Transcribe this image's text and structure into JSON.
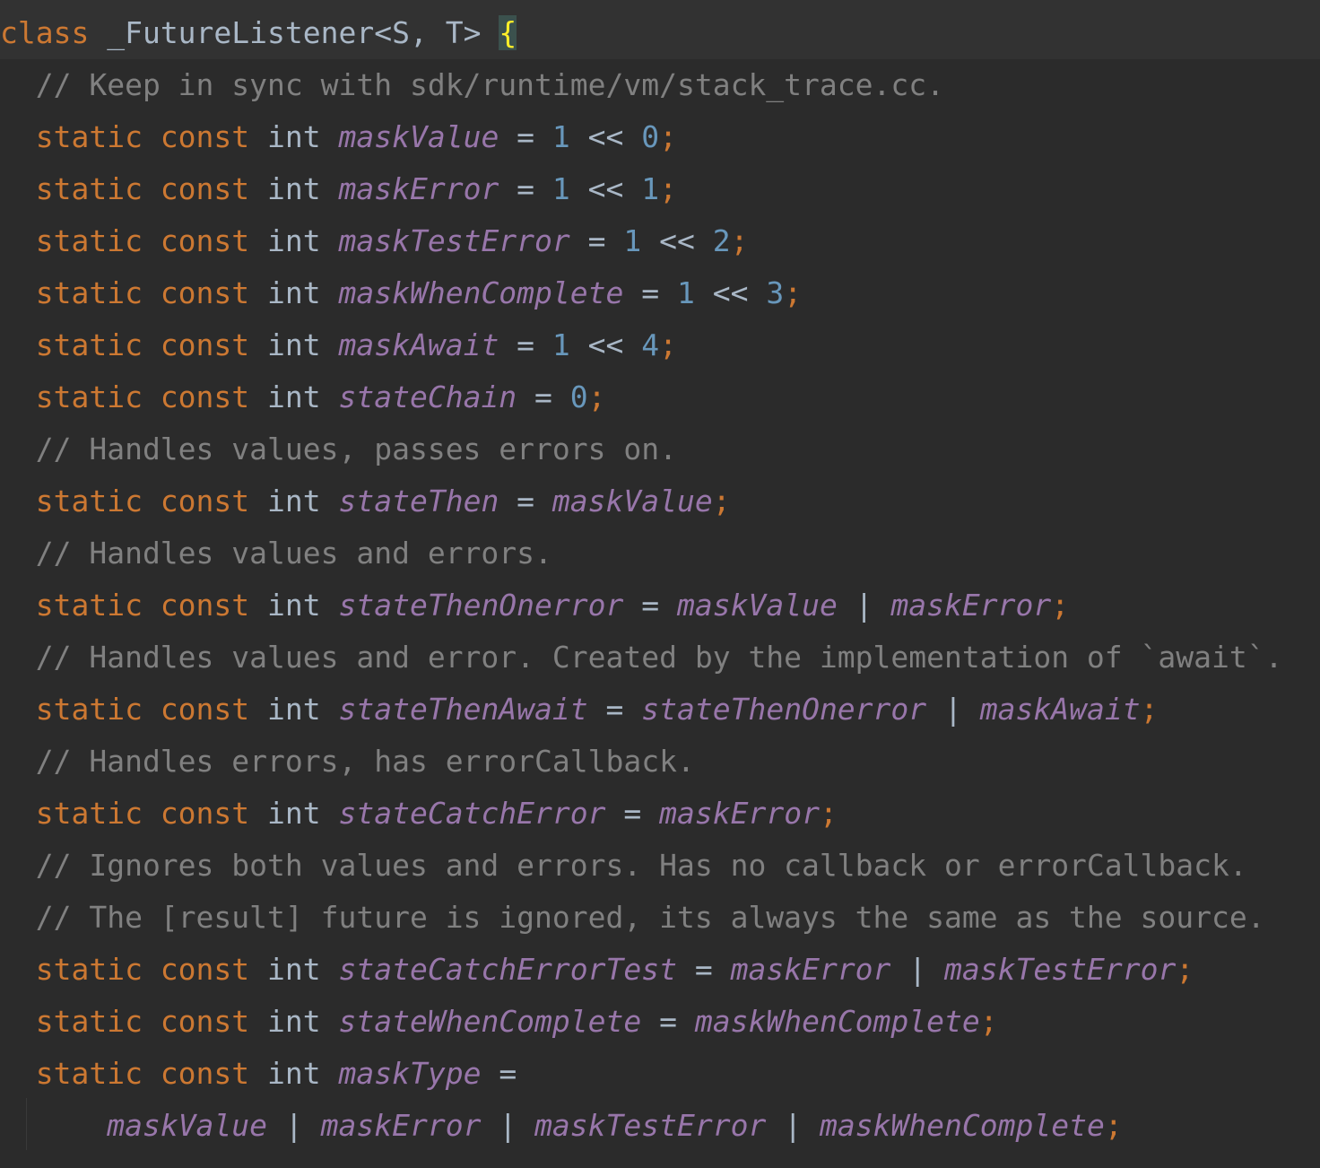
{
  "editor": {
    "colors": {
      "background": "#2b2b2b",
      "keyword": "#cc7832",
      "field": "#9876aa",
      "number": "#6897bb",
      "comment": "#808080",
      "text": "#a9b7c6",
      "brace_highlight": "#ffef28"
    },
    "lines": [
      {
        "tokens": [
          {
            "t": "kw",
            "v": "class"
          },
          {
            "t": "op",
            "v": " _FutureListener<S, T> "
          },
          {
            "t": "brace",
            "v": "{"
          }
        ]
      },
      {
        "tokens": [
          {
            "t": "cmt",
            "v": "  // Keep in sync with sdk/runtime/vm/stack_trace.cc."
          }
        ]
      },
      {
        "tokens": [
          {
            "t": "kw",
            "v": "  static const "
          },
          {
            "t": "op",
            "v": "int "
          },
          {
            "t": "fld",
            "v": "maskValue"
          },
          {
            "t": "op",
            "v": " = "
          },
          {
            "t": "num",
            "v": "1"
          },
          {
            "t": "op",
            "v": " << "
          },
          {
            "t": "num",
            "v": "0"
          },
          {
            "t": "semi",
            "v": ";"
          }
        ]
      },
      {
        "tokens": [
          {
            "t": "kw",
            "v": "  static const "
          },
          {
            "t": "op",
            "v": "int "
          },
          {
            "t": "fld",
            "v": "maskError"
          },
          {
            "t": "op",
            "v": " = "
          },
          {
            "t": "num",
            "v": "1"
          },
          {
            "t": "op",
            "v": " << "
          },
          {
            "t": "num",
            "v": "1"
          },
          {
            "t": "semi",
            "v": ";"
          }
        ]
      },
      {
        "tokens": [
          {
            "t": "kw",
            "v": "  static const "
          },
          {
            "t": "op",
            "v": "int "
          },
          {
            "t": "fld",
            "v": "maskTestError"
          },
          {
            "t": "op",
            "v": " = "
          },
          {
            "t": "num",
            "v": "1"
          },
          {
            "t": "op",
            "v": " << "
          },
          {
            "t": "num",
            "v": "2"
          },
          {
            "t": "semi",
            "v": ";"
          }
        ]
      },
      {
        "tokens": [
          {
            "t": "kw",
            "v": "  static const "
          },
          {
            "t": "op",
            "v": "int "
          },
          {
            "t": "fld",
            "v": "maskWhenComplete"
          },
          {
            "t": "op",
            "v": " = "
          },
          {
            "t": "num",
            "v": "1"
          },
          {
            "t": "op",
            "v": " << "
          },
          {
            "t": "num",
            "v": "3"
          },
          {
            "t": "semi",
            "v": ";"
          }
        ]
      },
      {
        "tokens": [
          {
            "t": "kw",
            "v": "  static const "
          },
          {
            "t": "op",
            "v": "int "
          },
          {
            "t": "fld",
            "v": "maskAwait"
          },
          {
            "t": "op",
            "v": " = "
          },
          {
            "t": "num",
            "v": "1"
          },
          {
            "t": "op",
            "v": " << "
          },
          {
            "t": "num",
            "v": "4"
          },
          {
            "t": "semi",
            "v": ";"
          }
        ]
      },
      {
        "tokens": [
          {
            "t": "kw",
            "v": "  static const "
          },
          {
            "t": "op",
            "v": "int "
          },
          {
            "t": "fld",
            "v": "stateChain"
          },
          {
            "t": "op",
            "v": " = "
          },
          {
            "t": "num",
            "v": "0"
          },
          {
            "t": "semi",
            "v": ";"
          }
        ]
      },
      {
        "tokens": [
          {
            "t": "cmt",
            "v": "  // Handles values, passes errors on."
          }
        ]
      },
      {
        "tokens": [
          {
            "t": "kw",
            "v": "  static const "
          },
          {
            "t": "op",
            "v": "int "
          },
          {
            "t": "fld",
            "v": "stateThen"
          },
          {
            "t": "op",
            "v": " = "
          },
          {
            "t": "fld",
            "v": "maskValue"
          },
          {
            "t": "semi",
            "v": ";"
          }
        ]
      },
      {
        "tokens": [
          {
            "t": "cmt",
            "v": "  // Handles values and errors."
          }
        ]
      },
      {
        "tokens": [
          {
            "t": "kw",
            "v": "  static const "
          },
          {
            "t": "op",
            "v": "int "
          },
          {
            "t": "fld",
            "v": "stateThenOnerror"
          },
          {
            "t": "op",
            "v": " = "
          },
          {
            "t": "fld",
            "v": "maskValue"
          },
          {
            "t": "op",
            "v": " | "
          },
          {
            "t": "fld",
            "v": "maskError"
          },
          {
            "t": "semi",
            "v": ";"
          }
        ]
      },
      {
        "tokens": [
          {
            "t": "cmt",
            "v": "  // Handles values and error. Created by the implementation of `await`."
          }
        ]
      },
      {
        "tokens": [
          {
            "t": "kw",
            "v": "  static const "
          },
          {
            "t": "op",
            "v": "int "
          },
          {
            "t": "fld",
            "v": "stateThenAwait"
          },
          {
            "t": "op",
            "v": " = "
          },
          {
            "t": "fld",
            "v": "stateThenOnerror"
          },
          {
            "t": "op",
            "v": " | "
          },
          {
            "t": "fld",
            "v": "maskAwait"
          },
          {
            "t": "semi",
            "v": ";"
          }
        ]
      },
      {
        "tokens": [
          {
            "t": "cmt",
            "v": "  // Handles errors, has errorCallback."
          }
        ]
      },
      {
        "tokens": [
          {
            "t": "kw",
            "v": "  static const "
          },
          {
            "t": "op",
            "v": "int "
          },
          {
            "t": "fld",
            "v": "stateCatchError"
          },
          {
            "t": "op",
            "v": " = "
          },
          {
            "t": "fld",
            "v": "maskError"
          },
          {
            "t": "semi",
            "v": ";"
          }
        ]
      },
      {
        "tokens": [
          {
            "t": "cmt",
            "v": "  // Ignores both values and errors. Has no callback or errorCallback."
          }
        ]
      },
      {
        "tokens": [
          {
            "t": "cmt",
            "v": "  // The [result] future is ignored, its always the same as the source."
          }
        ]
      },
      {
        "tokens": [
          {
            "t": "kw",
            "v": "  static const "
          },
          {
            "t": "op",
            "v": "int "
          },
          {
            "t": "fld",
            "v": "stateCatchErrorTest"
          },
          {
            "t": "op",
            "v": " = "
          },
          {
            "t": "fld",
            "v": "maskError"
          },
          {
            "t": "op",
            "v": " | "
          },
          {
            "t": "fld",
            "v": "maskTestError"
          },
          {
            "t": "semi",
            "v": ";"
          }
        ]
      },
      {
        "tokens": [
          {
            "t": "kw",
            "v": "  static const "
          },
          {
            "t": "op",
            "v": "int "
          },
          {
            "t": "fld",
            "v": "stateWhenComplete"
          },
          {
            "t": "op",
            "v": " = "
          },
          {
            "t": "fld",
            "v": "maskWhenComplete"
          },
          {
            "t": "semi",
            "v": ";"
          }
        ]
      },
      {
        "tokens": [
          {
            "t": "kw",
            "v": "  static const "
          },
          {
            "t": "op",
            "v": "int "
          },
          {
            "t": "fld",
            "v": "maskType"
          },
          {
            "t": "op",
            "v": " ="
          }
        ]
      },
      {
        "tokens": [
          {
            "t": "op",
            "v": "      "
          },
          {
            "t": "fld",
            "v": "maskValue"
          },
          {
            "t": "op",
            "v": " | "
          },
          {
            "t": "fld",
            "v": "maskError"
          },
          {
            "t": "op",
            "v": " | "
          },
          {
            "t": "fld",
            "v": "maskTestError"
          },
          {
            "t": "op",
            "v": " | "
          },
          {
            "t": "fld",
            "v": "maskWhenComplete"
          },
          {
            "t": "semi",
            "v": ";"
          }
        ]
      }
    ]
  }
}
